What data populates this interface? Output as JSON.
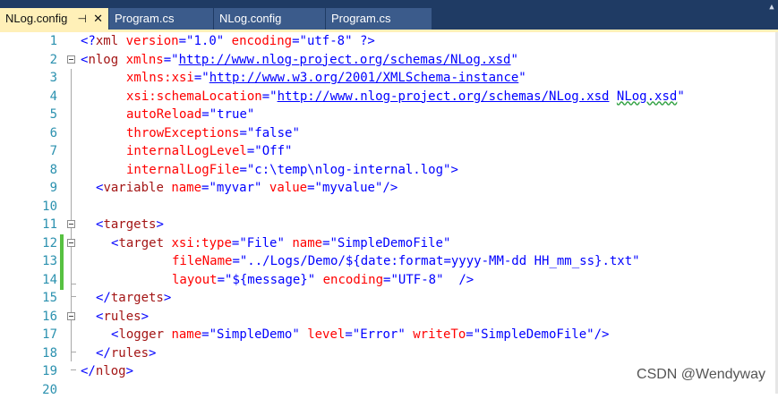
{
  "tabs": [
    {
      "label": "NLog.config",
      "active": true
    },
    {
      "label": "Program.cs",
      "active": false
    },
    {
      "label": "NLog.config",
      "active": false
    },
    {
      "label": "Program.cs",
      "active": false
    }
  ],
  "icons": {
    "pin": "pin-icon",
    "close": "close-icon"
  },
  "line_numbers": [
    "1",
    "2",
    "3",
    "4",
    "5",
    "6",
    "7",
    "8",
    "9",
    "10",
    "11",
    "12",
    "13",
    "14",
    "15",
    "16",
    "17",
    "18",
    "19",
    "20"
  ],
  "code": {
    "l1": {
      "open": "<?",
      "name": "xml",
      "a1": "version",
      "eq1": "=\"",
      "v1": "1.0",
      "q1": "\"",
      "a2": "encoding",
      "eq2": "=\"",
      "v2": "utf-8",
      "q2": "\"",
      "close": "?>"
    },
    "l2": {
      "open": "<",
      "tag": "nlog",
      "attr": "xmlns",
      "eq": "=\"",
      "url": "http://www.nlog-project.org/schemas/NLog.xsd",
      "q": "\""
    },
    "l3": {
      "attr": "xmlns:xsi",
      "eq": "=\"",
      "url": "http://www.w3.org/2001/XMLSchema-instance",
      "q": "\""
    },
    "l4": {
      "attr": "xsi:schemaLocation",
      "eq": "=\"",
      "url": "http://www.nlog-project.org/schemas/NLog.xsd",
      "sp": " ",
      "val": "NLog.xsd",
      "q": "\""
    },
    "l5": {
      "attr": "autoReload",
      "eq": "=\"",
      "val": "true",
      "q": "\""
    },
    "l6": {
      "attr": "throwExceptions",
      "eq": "=\"",
      "val": "false",
      "q": "\""
    },
    "l7": {
      "attr": "internalLogLevel",
      "eq": "=\"",
      "val": "Off",
      "q": "\""
    },
    "l8": {
      "attr": "internalLogFile",
      "eq": "=\"",
      "val": "c:\\temp\\nlog-internal.log",
      "q": "\"",
      "close": ">"
    },
    "l9": {
      "open": "<",
      "tag": "variable",
      "a1": "name",
      "eq1": "=\"",
      "v1": "myvar",
      "q1": "\"",
      "a2": "value",
      "eq2": "=\"",
      "v2": "myvalue",
      "q2": "\"",
      "close": "/>"
    },
    "l11": {
      "open": "<",
      "tag": "targets",
      "close": ">"
    },
    "l12": {
      "open": "<",
      "tag": "target",
      "a1": "xsi:type",
      "eq1": "=\"",
      "v1": "File",
      "q1": "\"",
      "a2": "name",
      "eq2": "=\"",
      "v2": "SimpleDemoFile",
      "q2": "\""
    },
    "l13": {
      "attr": "fileName",
      "eq": "=\"",
      "val": "../Logs/Demo/${date:format=yyyy-MM-dd HH_mm_ss}.txt",
      "q": "\""
    },
    "l14": {
      "a1": "layout",
      "eq1": "=\"",
      "v1": "${message}",
      "q1": "\"",
      "a2": "encoding",
      "eq2": "=\"",
      "v2": "UTF-8",
      "q2": "\"",
      "close": "/>"
    },
    "l15": {
      "open": "</",
      "tag": "targets",
      "close": ">"
    },
    "l16": {
      "open": "<",
      "tag": "rules",
      "close": ">"
    },
    "l17": {
      "open": "<",
      "tag": "logger",
      "a1": "name",
      "eq1": "=\"",
      "v1": "SimpleDemo",
      "q1": "\"",
      "a2": "level",
      "eq2": "=\"",
      "v2": "Error",
      "q2": "\"",
      "a3": "writeTo",
      "eq3": "=\"",
      "v3": "SimpleDemoFile",
      "q3": "\"",
      "close": "/>"
    },
    "l18": {
      "open": "</",
      "tag": "rules",
      "close": ">"
    },
    "l19": {
      "open": "</",
      "tag": "nlog",
      "close": ">"
    }
  },
  "watermark": "CSDN @Wendyway"
}
